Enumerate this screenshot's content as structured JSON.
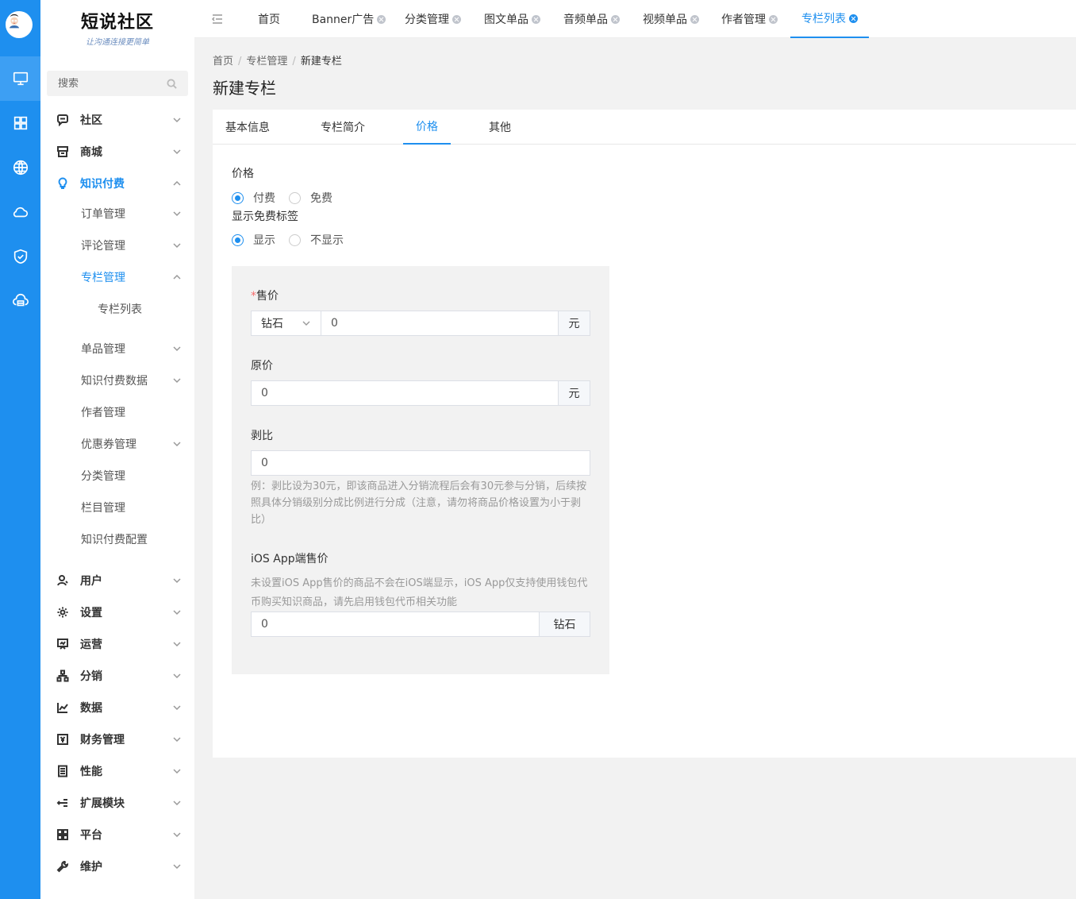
{
  "brand": {
    "title": "短说社区",
    "subtitle": "让沟通连接更简单"
  },
  "search": {
    "placeholder": "搜索"
  },
  "rail": [
    "monitor-icon",
    "apps-icon",
    "globe-icon",
    "cloud-icon",
    "shield-icon",
    "cloud-server-icon"
  ],
  "sidebar": {
    "items": [
      {
        "label": "社区",
        "icon": "chat-icon"
      },
      {
        "label": "商城",
        "icon": "store-icon"
      },
      {
        "label": "知识付费",
        "icon": "bulb-icon"
      },
      {
        "label": "订单管理"
      },
      {
        "label": "评论管理"
      },
      {
        "label": "专栏管理"
      },
      {
        "label": "专栏列表"
      },
      {
        "label": "单品管理"
      },
      {
        "label": "知识付费数据"
      },
      {
        "label": "作者管理"
      },
      {
        "label": "优惠券管理"
      },
      {
        "label": "分类管理"
      },
      {
        "label": "栏目管理"
      },
      {
        "label": "知识付费配置"
      },
      {
        "label": "用户",
        "icon": "user-icon"
      },
      {
        "label": "设置",
        "icon": "gear-icon"
      },
      {
        "label": "运营",
        "icon": "presentation-icon"
      },
      {
        "label": "分销",
        "icon": "sitemap-icon"
      },
      {
        "label": "数据",
        "icon": "chart-icon"
      },
      {
        "label": "财务管理",
        "icon": "finance-icon"
      },
      {
        "label": "性能",
        "icon": "server-icon"
      },
      {
        "label": "扩展模块",
        "icon": "extend-icon"
      },
      {
        "label": "平台",
        "icon": "platform-icon"
      },
      {
        "label": "维护",
        "icon": "wrench-icon"
      }
    ]
  },
  "tabs": [
    "首页",
    "Banner广告",
    "分类管理",
    "图文单品",
    "音频单品",
    "视频单品",
    "作者管理",
    "专栏列表"
  ],
  "breadcrumb": {
    "home": "首页",
    "parent": "专栏管理",
    "current": "新建专栏"
  },
  "page_title": "新建专栏",
  "form_tabs": [
    "基本信息",
    "专栏简介",
    "价格",
    "其他"
  ],
  "form": {
    "price_label": "价格",
    "price_options": [
      "付费",
      "免费"
    ],
    "free_tag_label": "显示免费标签",
    "free_tag_options": [
      "显示",
      "不显示"
    ],
    "sale_required": "*",
    "sale_label": "售价",
    "currency": "钻石",
    "sale_value": "0",
    "unit": "元",
    "original_label": "原价",
    "original_value": "0",
    "strip_label": "剥比",
    "strip_value": "0",
    "strip_hint": "例：剥比设为30元，即该商品进入分销流程后会有30元参与分销，后续按照具体分销级别分成比例进行分成（注意，请勿将商品价格设置为小于剥比）",
    "ios_label": "iOS App端售价",
    "ios_hint": "未设置iOS App售价的商品不会在iOS端显示，iOS App仅支持使用钱包代币购买知识商品，请先启用钱包代币相关功能",
    "ios_value": "0",
    "ios_unit": "钻石"
  },
  "colors": {
    "accent": "#1e8fef",
    "required": "#f56c6c"
  }
}
